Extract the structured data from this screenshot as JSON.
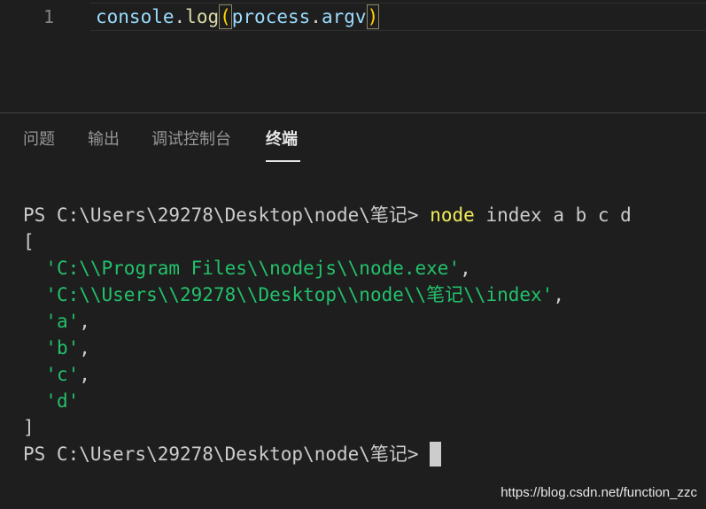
{
  "editor": {
    "line_number": "1",
    "code": {
      "object": "console",
      "dot1": ".",
      "method": "log",
      "open_paren": "(",
      "arg_object": "process",
      "dot2": ".",
      "arg_prop": "argv",
      "close_paren": ")"
    }
  },
  "panel": {
    "tabs": [
      {
        "label": "问题",
        "active": false
      },
      {
        "label": "输出",
        "active": false
      },
      {
        "label": "调试控制台",
        "active": false
      },
      {
        "label": "终端",
        "active": true
      }
    ]
  },
  "terminal": {
    "prompt": "PS C:\\Users\\29278\\Desktop\\node\\笔记> ",
    "command": "node",
    "command_args": " index a b c d",
    "open_bracket": "[",
    "items": [
      {
        "value": "'C:\\\\Program Files\\\\nodejs\\\\node.exe'",
        "suffix": ","
      },
      {
        "value": "'C:\\\\Users\\\\29278\\\\Desktop\\\\node\\\\笔记\\\\index'",
        "suffix": ","
      },
      {
        "value": "'a'",
        "suffix": ","
      },
      {
        "value": "'b'",
        "suffix": ","
      },
      {
        "value": "'c'",
        "suffix": ","
      },
      {
        "value": "'d'",
        "suffix": ""
      }
    ],
    "close_bracket": "]",
    "prompt2": "PS C:\\Users\\29278\\Desktop\\node\\笔记> "
  },
  "watermark": "https://blog.csdn.net/function_zzc",
  "colors": {
    "background": "#1e1e1e",
    "command": "#f1ec5a",
    "string": "#23c16b",
    "variable": "#9cdcfe",
    "function": "#dcdcaa",
    "bracket_match": "#ffd700"
  }
}
